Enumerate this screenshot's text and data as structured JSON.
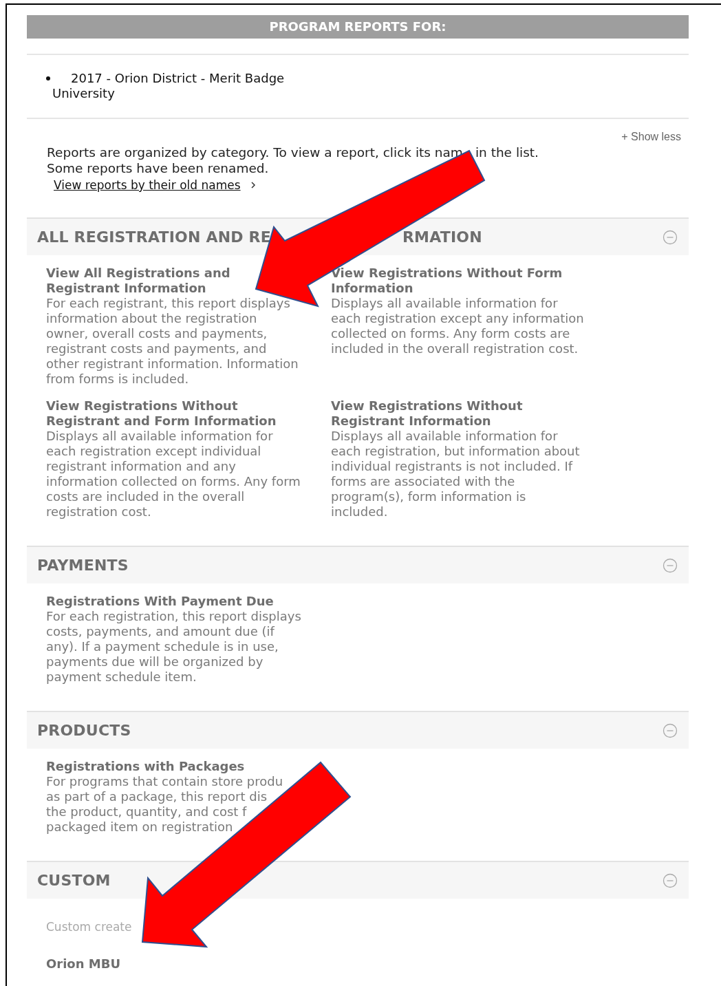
{
  "header": {
    "title": "PROGRAM REPORTS FOR:"
  },
  "programs": [
    "2017 - Orion District - Merit Badge University"
  ],
  "show_toggle": {
    "label": "+ Show less"
  },
  "intro": {
    "lines": [
      {
        "parts": [
          "Reports are organized by category. To view a report, click its nam",
          "in the list."
        ]
      },
      {
        "parts": [
          "Some reports have been renamed."
        ]
      }
    ],
    "link": "View reports by their old names"
  },
  "sections": [
    {
      "title_parts": [
        "ALL REGISTRATION AND RE",
        "RMATION"
      ],
      "expanded": true,
      "reports": [
        {
          "title_lines": [
            "View All Registrations and",
            "Registrant Information"
          ],
          "description_lines": [
            "For each registrant, this report displays",
            "information about the registration",
            "owner, overall costs and payments,",
            "registrant costs and payments, and",
            "other registrant information. Information",
            "from forms is included."
          ]
        },
        {
          "title_lines": [
            "View Registrations Without Form",
            "Information"
          ],
          "description_lines": [
            "Displays all available information for",
            "each registration except any information",
            "collected on forms. Any form costs are",
            "included in the overall registration cost."
          ]
        },
        {
          "title_lines": [
            "View Registrations Without",
            "Registrant and Form Information"
          ],
          "description_lines": [
            "Displays all available information for",
            "each registration except individual",
            "registrant information and any",
            "information collected on forms. Any form",
            "costs are included in the overall",
            "registration cost."
          ]
        },
        {
          "title_lines": [
            "View Registrations Without",
            "Registrant Information"
          ],
          "description_lines": [
            "Displays all available information for",
            "each registration, but information about",
            "individual registrants is not included. If",
            "forms are associated with the",
            "program(s), form information is",
            "included."
          ]
        }
      ]
    },
    {
      "title_parts": [
        "PAYMENTS"
      ],
      "expanded": true,
      "reports": [
        {
          "title_lines": [
            "Registrations With Payment Due"
          ],
          "description_lines": [
            "For each registration, this report displays",
            "costs, payments, and amount due (if",
            "any). If a payment schedule is in use,",
            "payments due will be organized by",
            "payment schedule item."
          ]
        }
      ]
    },
    {
      "title_parts": [
        "PRODUCTS"
      ],
      "expanded": true,
      "reports": [
        {
          "title_lines": [
            "Registrations with Packages"
          ],
          "description_lines": [
            "For programs that contain store produ",
            "as part of a package, this report dis",
            "the product, quantity, and cost f",
            "packaged item on registration"
          ]
        }
      ]
    },
    {
      "title_parts": [
        "CUSTOM"
      ],
      "expanded": true,
      "note": "Custom create",
      "reports": [
        {
          "title_lines": [
            "Orion MBU"
          ]
        }
      ]
    }
  ]
}
